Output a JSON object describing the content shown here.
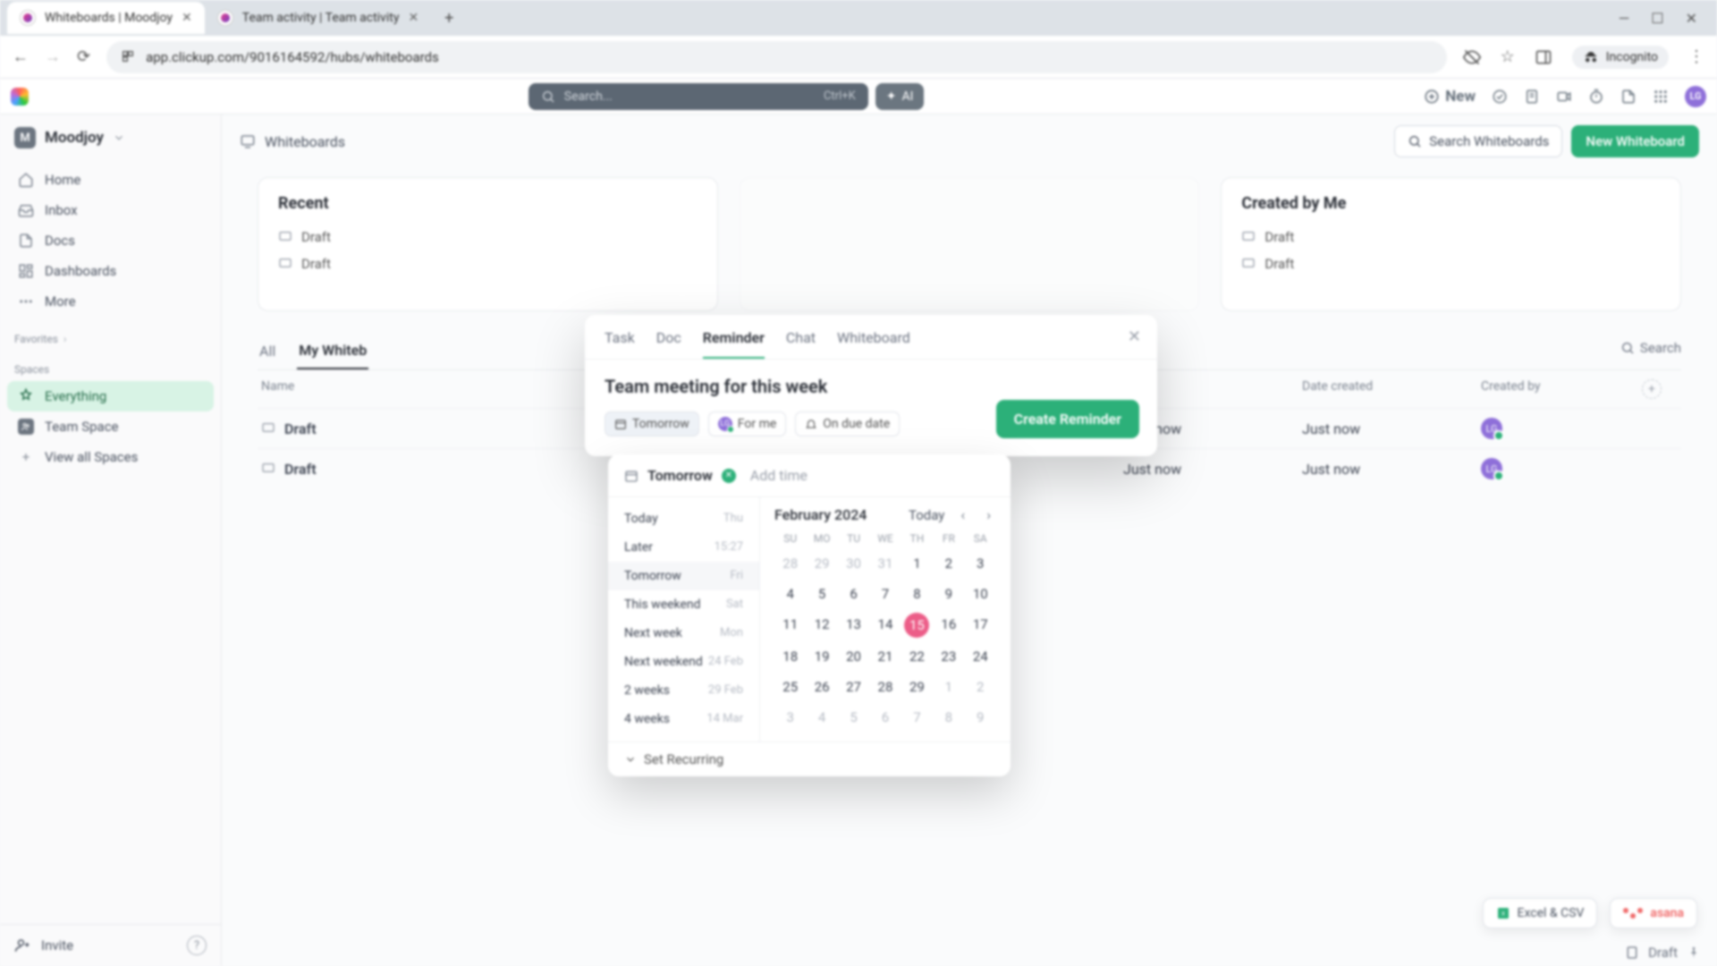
{
  "browser": {
    "tabs": [
      {
        "title": "Whiteboards | Moodjoy",
        "active": true
      },
      {
        "title": "Team activity | Team activity",
        "active": false
      }
    ],
    "url": "app.clickup.com/9016164592/hubs/whiteboards",
    "incognito_label": "Incognito"
  },
  "topbar": {
    "search_placeholder": "Search...",
    "search_shortcut": "Ctrl+K",
    "ai_label": "AI",
    "new_label": "New",
    "avatar_initials": "LG"
  },
  "workspace": {
    "name": "Moodjoy",
    "badge": "M",
    "nav": [
      {
        "icon": "home-icon",
        "label": "Home"
      },
      {
        "icon": "inbox-icon",
        "label": "Inbox"
      },
      {
        "icon": "doc-icon",
        "label": "Docs"
      },
      {
        "icon": "dashboard-icon",
        "label": "Dashboards"
      },
      {
        "icon": "more-icon",
        "label": "More"
      }
    ],
    "favorites_label": "Favorites",
    "spaces_label": "Spaces",
    "spaces": [
      {
        "label": "Everything",
        "active": true,
        "badge": ""
      },
      {
        "label": "Team Space",
        "active": false,
        "badge": "T"
      },
      {
        "label": "View all Spaces",
        "active": false,
        "badge": "+"
      }
    ],
    "invite_label": "Invite"
  },
  "page": {
    "breadcrumb_icon": "whiteboard-icon",
    "breadcrumb": "Whiteboards",
    "search_whiteboards": "Search Whiteboards",
    "new_whiteboard": "New Whiteboard"
  },
  "cards": {
    "recent": {
      "title": "Recent",
      "items": [
        "Draft",
        "Draft"
      ]
    },
    "created": {
      "title": "Created by Me",
      "items": [
        "Draft",
        "Draft"
      ]
    }
  },
  "table": {
    "tabs": {
      "all": "All",
      "mine": "My Whiteb"
    },
    "search_label": "Search",
    "columns": {
      "name": "Name",
      "date_updated": "",
      "date_created": "Date created",
      "created_by": "Created by"
    },
    "rows": [
      {
        "name": "Draft",
        "date_updated": "Just now",
        "date_created": "Just now",
        "avatar": "LG"
      },
      {
        "name": "Draft",
        "date_updated": "Just now",
        "date_created": "Just now",
        "avatar": "LG"
      }
    ]
  },
  "modal": {
    "tabs": [
      "Task",
      "Doc",
      "Reminder",
      "Chat",
      "Whiteboard"
    ],
    "active_tab": "Reminder",
    "title": "Team meeting for this week",
    "chips": {
      "date": "Tomorrow",
      "assignee": "For me",
      "notify": "On due date"
    },
    "create_button": "Create Reminder"
  },
  "date_popover": {
    "selected_label": "Tomorrow",
    "add_time": "Add time",
    "quick": [
      {
        "label": "Today",
        "hint": "Thu"
      },
      {
        "label": "Later",
        "hint": "15:27"
      },
      {
        "label": "Tomorrow",
        "hint": "Fri"
      },
      {
        "label": "This weekend",
        "hint": "Sat"
      },
      {
        "label": "Next week",
        "hint": "Mon"
      },
      {
        "label": "Next weekend",
        "hint": "24 Feb"
      },
      {
        "label": "2 weeks",
        "hint": "29 Feb"
      },
      {
        "label": "4 weeks",
        "hint": "14 Mar"
      }
    ],
    "set_recurring": "Set Recurring",
    "calendar": {
      "month_label": "February 2024",
      "today_label": "Today",
      "dow": [
        "SU",
        "MO",
        "TU",
        "WE",
        "TH",
        "FR",
        "SA"
      ],
      "weeks": [
        [
          {
            "n": 28,
            "o": true
          },
          {
            "n": 29,
            "o": true
          },
          {
            "n": 30,
            "o": true
          },
          {
            "n": 31,
            "o": true
          },
          {
            "n": 1
          },
          {
            "n": 2
          },
          {
            "n": 3
          }
        ],
        [
          {
            "n": 4
          },
          {
            "n": 5
          },
          {
            "n": 6
          },
          {
            "n": 7
          },
          {
            "n": 8
          },
          {
            "n": 9
          },
          {
            "n": 10
          }
        ],
        [
          {
            "n": 11
          },
          {
            "n": 12
          },
          {
            "n": 13
          },
          {
            "n": 14
          },
          {
            "n": 15,
            "today": true
          },
          {
            "n": 16
          },
          {
            "n": 17
          }
        ],
        [
          {
            "n": 18
          },
          {
            "n": 19
          },
          {
            "n": 20
          },
          {
            "n": 21
          },
          {
            "n": 22
          },
          {
            "n": 23
          },
          {
            "n": 24
          }
        ],
        [
          {
            "n": 25
          },
          {
            "n": 26
          },
          {
            "n": 27
          },
          {
            "n": 28
          },
          {
            "n": 29
          },
          {
            "n": 1,
            "o": true
          },
          {
            "n": 2,
            "o": true
          }
        ],
        [
          {
            "n": 3,
            "o": true
          },
          {
            "n": 4,
            "o": true
          },
          {
            "n": 5,
            "o": true
          },
          {
            "n": 6,
            "o": true
          },
          {
            "n": 7,
            "o": true
          },
          {
            "n": 8,
            "o": true
          },
          {
            "n": 9,
            "o": true
          }
        ]
      ]
    }
  },
  "floats": {
    "excel": "Excel & CSV",
    "asana": "asana"
  },
  "status": {
    "draft": "Draft"
  }
}
